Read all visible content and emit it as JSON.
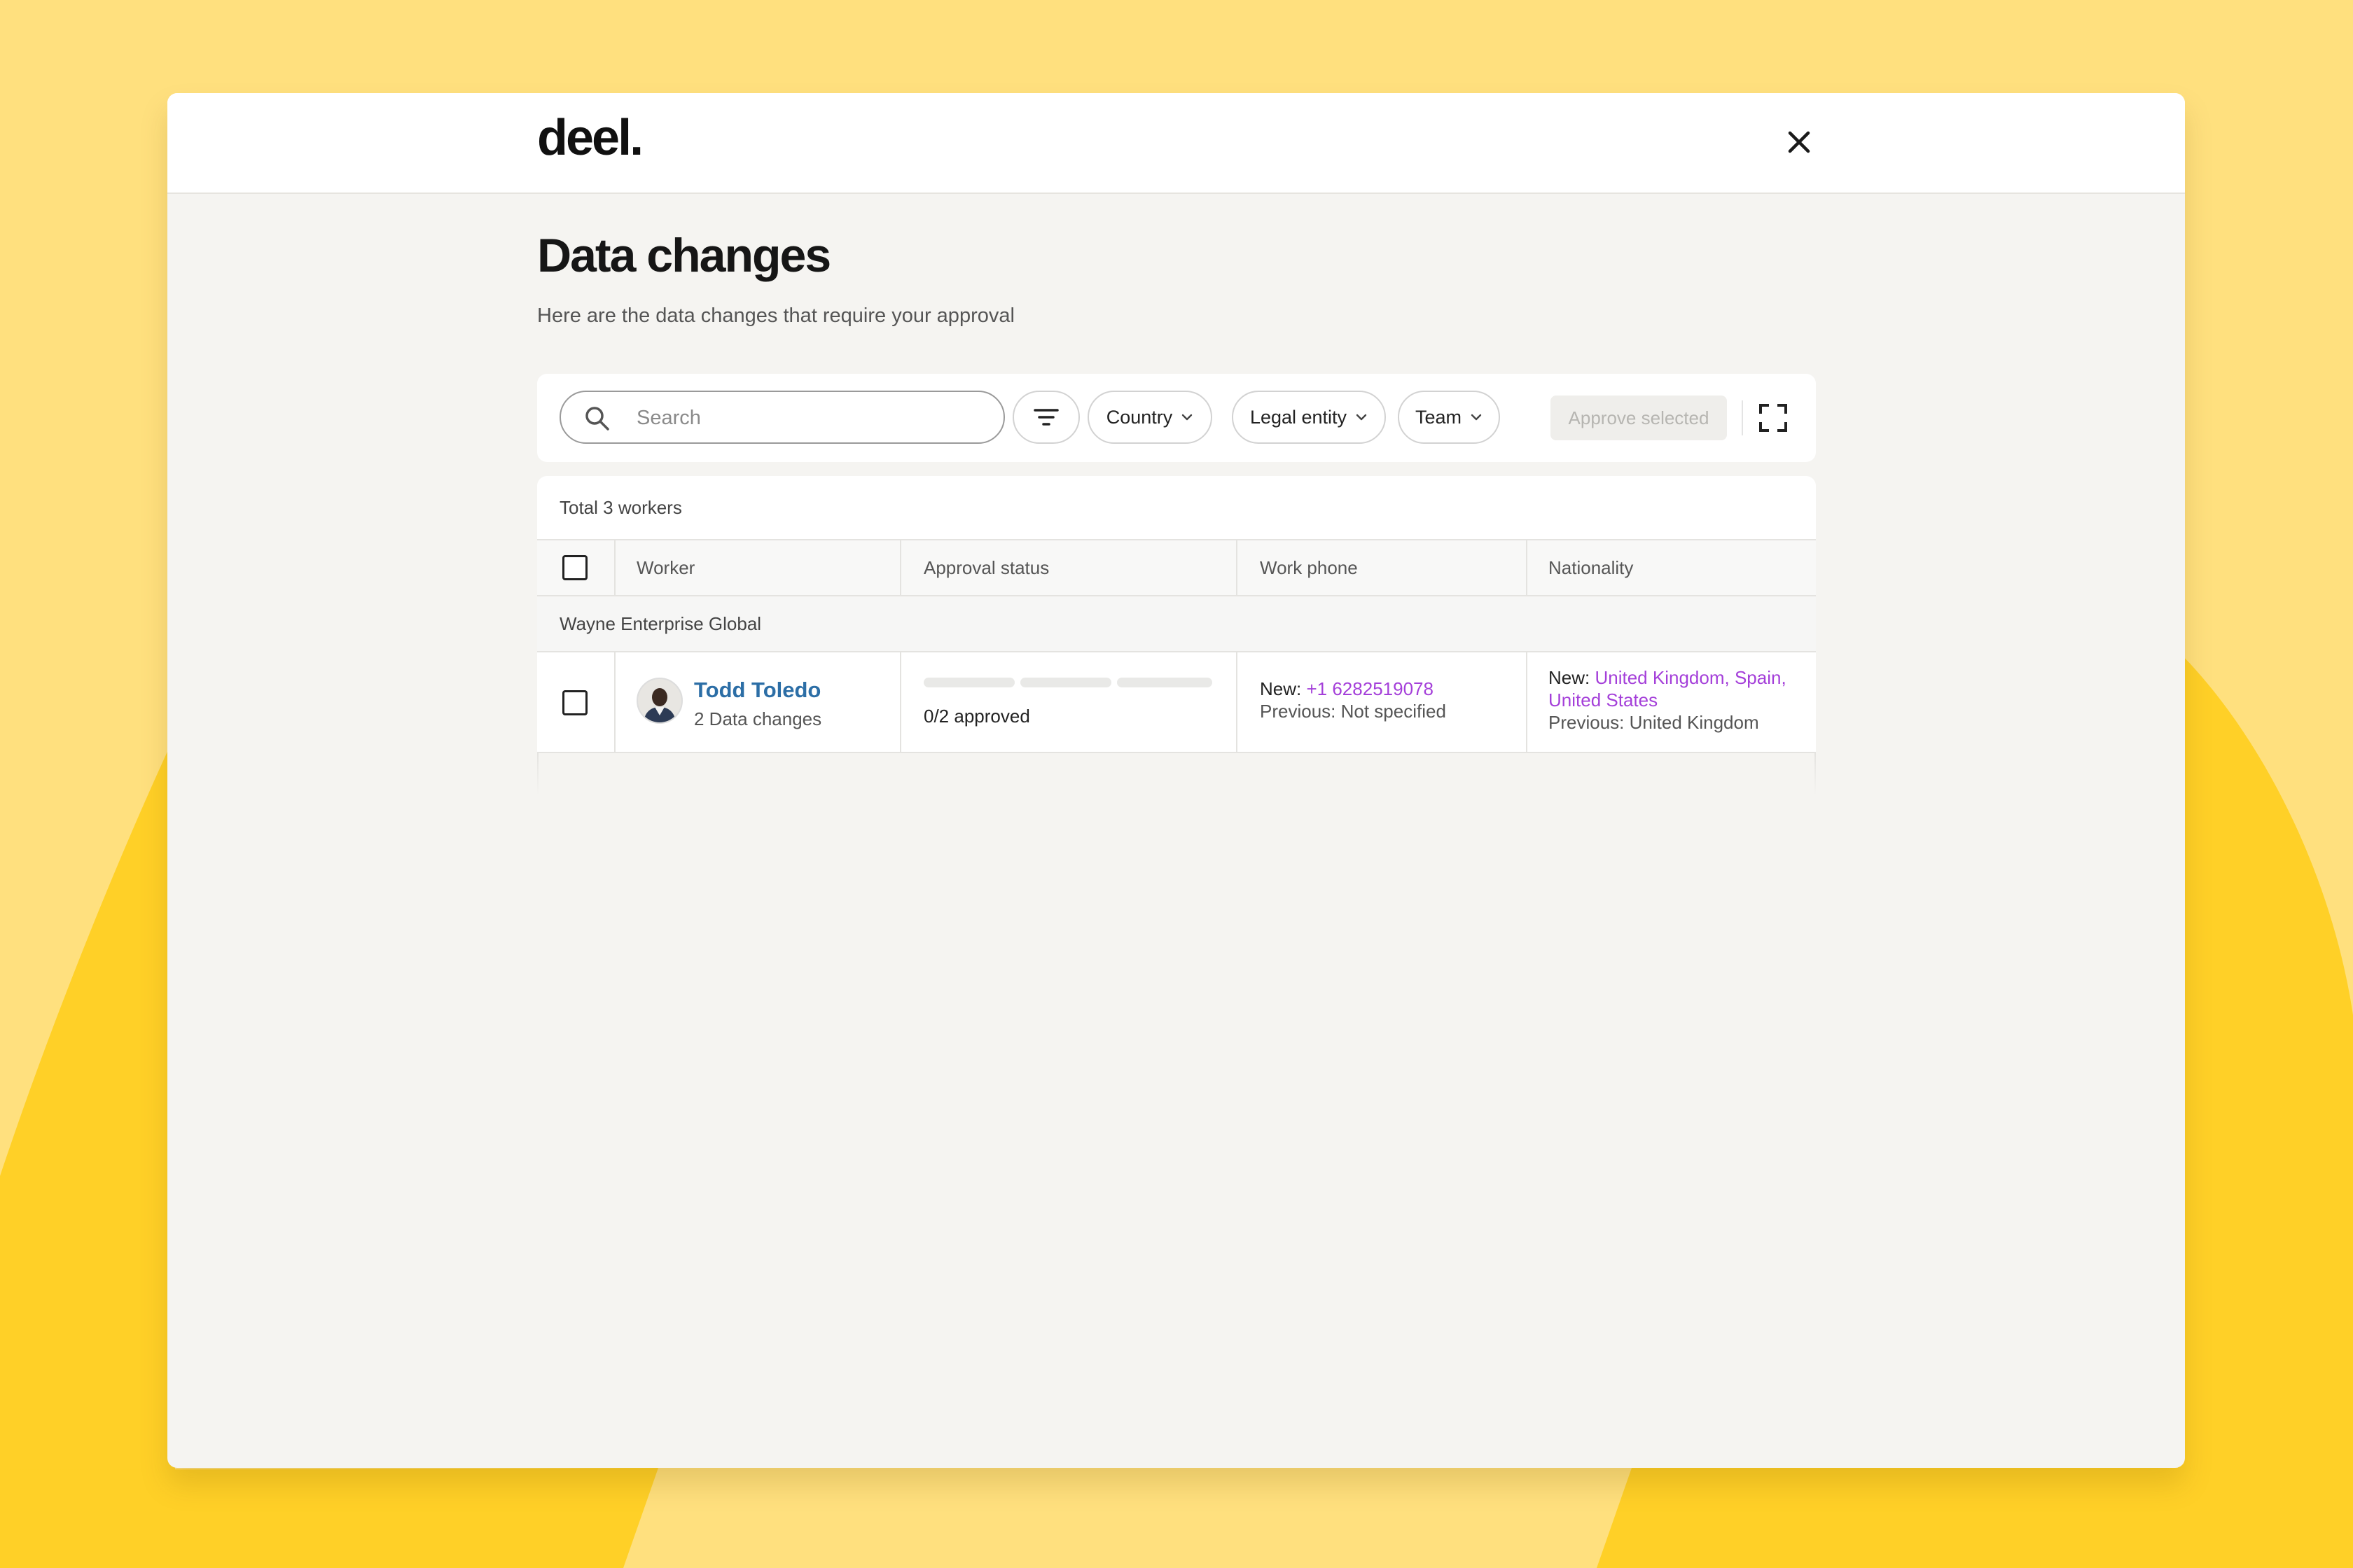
{
  "app": {
    "logo_text": "deel.",
    "close_icon": "close-icon"
  },
  "page": {
    "title": "Data changes",
    "subtitle": "Here are the data changes that require your approval"
  },
  "toolbar": {
    "search_placeholder": "Search",
    "search_icon": "search-icon",
    "filter_icon": "filter-icon",
    "filters": [
      {
        "label": "Country",
        "icon": "chevron-down-icon"
      },
      {
        "label": "Legal entity",
        "icon": "chevron-down-icon"
      },
      {
        "label": "Team",
        "icon": "chevron-down-icon"
      }
    ],
    "approve_label": "Approve selected",
    "expand_icon": "expand-icon"
  },
  "table": {
    "total_label": "Total 3 workers",
    "columns": [
      "Worker",
      "Approval status",
      "Work phone",
      "Nationality"
    ],
    "groups": [
      {
        "name": "Wayne Enterprise Global",
        "rows": [
          {
            "worker_name": "Todd Toledo",
            "worker_sub": "2 Data changes",
            "approval_status": "0/2 approved",
            "approved_fraction": 0,
            "work_phone": {
              "new_label": "New:",
              "new_value": "+1 6282519078",
              "previous_label": "Previous:",
              "previous_value": "Not specified"
            },
            "nationality": {
              "new_label": "New:",
              "new_values": [
                "United Kingdom",
                "Spain",
                "United States"
              ],
              "previous_label": "Previous:",
              "previous_value": "United Kingdom"
            }
          }
        ]
      }
    ]
  },
  "colors": {
    "background": "#FFE07E",
    "accent_yellow": "#FFD027",
    "link_blue": "#2C6EA6",
    "change_purple": "#A43FD9",
    "disabled_button": "#EFEEEB"
  }
}
